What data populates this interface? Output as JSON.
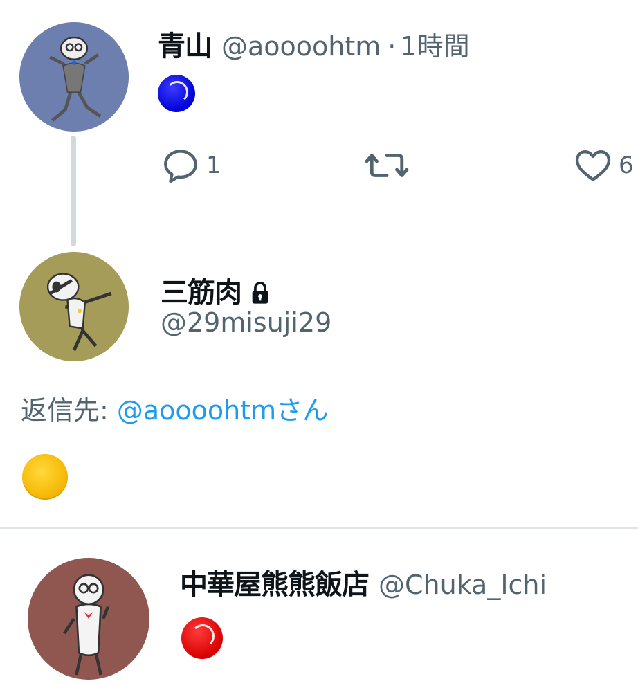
{
  "tweets": [
    {
      "display_name": "青山",
      "handle": "@aoooohtm",
      "separator": "·",
      "time": "1時間",
      "emoji": "blue-circle",
      "emoji_color": "#0000ee",
      "avatar_bg": "#6d7fae",
      "actions": {
        "reply_count": "1",
        "retweet_count": "",
        "like_count": "6"
      }
    },
    {
      "display_name": "三筋肉",
      "handle": "@29misuji29",
      "protected_icon": "lock-icon",
      "reply_prefix": "返信先: ",
      "reply_to": "@aoooohtmさん",
      "emoji": "yellow-circle",
      "emoji_color": "#f9c300",
      "avatar_bg": "#a49c58"
    },
    {
      "display_name": "中華屋熊熊飯店",
      "handle": "@Chuka_Ichi",
      "emoji": "red-circle",
      "emoji_color": "#ee0000",
      "avatar_bg": "#8f5750"
    }
  ],
  "colors": {
    "text_primary": "#0f1419",
    "text_secondary": "#536471",
    "link": "#1d9bf0",
    "thread_line": "#cfd9de"
  }
}
